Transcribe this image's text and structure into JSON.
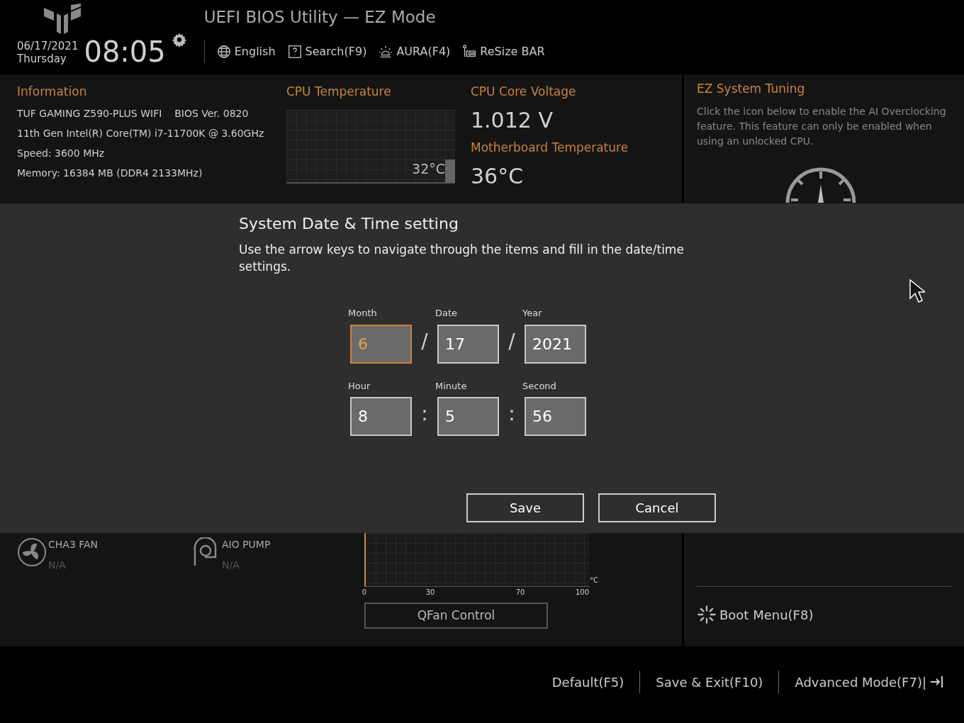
{
  "header": {
    "title": "UEFI BIOS Utility — EZ Mode",
    "date": "06/17/2021",
    "weekday": "Thursday",
    "time": "08:05",
    "tools": [
      {
        "kind": "globe",
        "label": "English"
      },
      {
        "kind": "help",
        "label": "Search(F9)"
      },
      {
        "kind": "aura",
        "label": "AURA(F4)"
      },
      {
        "kind": "card",
        "label": "ReSize BAR"
      }
    ]
  },
  "information": {
    "title": "Information",
    "lines": [
      "TUF GAMING Z590-PLUS WIFI    BIOS Ver. 0820",
      "11th Gen Intel(R) Core(TM) i7-11700K @ 3.60GHz",
      "Speed: 3600 MHz",
      "Memory: 16384 MB (DDR4 2133MHz)"
    ]
  },
  "cpu_temperature": {
    "title": "CPU Temperature",
    "reading": "32°C"
  },
  "cpu_core_voltage": {
    "title": "CPU Core Voltage",
    "value": "1.012 V"
  },
  "motherboard_temperature": {
    "title": "Motherboard Temperature",
    "value": "36°C"
  },
  "ez_system_tuning": {
    "title": "EZ System Tuning",
    "description": "Click the icon below to enable the AI Overclocking feature.  This feature can only be enabled when using an unlocked CPU."
  },
  "dialog": {
    "title": "System Date & Time setting",
    "message": "Use the arrow keys to navigate through the items and fill in the date/time settings.",
    "rows": [
      {
        "separator": "/",
        "fields": [
          {
            "label": "Month",
            "value": "6",
            "selected": true
          },
          {
            "label": "Date",
            "value": "17",
            "selected": false
          },
          {
            "label": "Year",
            "value": "2021",
            "selected": false
          }
        ]
      },
      {
        "separator": ":",
        "fields": [
          {
            "label": "Hour",
            "value": "8",
            "selected": false
          },
          {
            "label": "Minute",
            "value": "5",
            "selected": false
          },
          {
            "label": "Second",
            "value": "56",
            "selected": false
          }
        ]
      }
    ],
    "buttons": [
      "Save",
      "Cancel"
    ]
  },
  "fans": [
    {
      "kind": "fan",
      "name": "CHA3 FAN",
      "value": "N/A"
    },
    {
      "kind": "pump",
      "name": "AIO PUMP",
      "value": "N/A"
    }
  ],
  "fan_chart": {
    "xticks": [
      "0",
      "30",
      "70",
      "100"
    ],
    "unit": "°C",
    "button": "QFan Control"
  },
  "boot_menu": "Boot Menu(F8)",
  "footer": [
    "Default(F5)",
    "Save & Exit(F10)",
    "Advanced Mode(F7)|"
  ]
}
